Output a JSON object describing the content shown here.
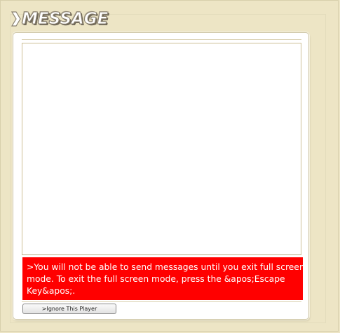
{
  "header": {
    "title": "MESSAGE"
  },
  "warning": {
    "text": ">You will not be able to send messages until you exit full screen mode. To exit the full screen mode, press the &apos;Escape Key&apos;."
  },
  "buttons": {
    "ignore_label": ">Ignore This Player"
  },
  "colors": {
    "background": "#ede5c5",
    "warning_bg": "#ff0000",
    "warning_text": "#ffffff",
    "panel_bg": "#ffffff"
  },
  "icons": {
    "header_arrow": "chevron-right-icon"
  }
}
